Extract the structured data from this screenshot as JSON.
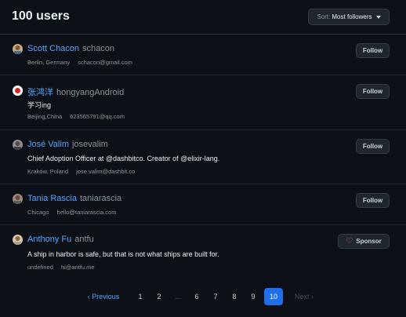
{
  "header": {
    "title": "100 users"
  },
  "sort": {
    "label": "Sort:",
    "value": "Most followers"
  },
  "users": [
    {
      "display_name": "Scott Chacon",
      "login": "schacon",
      "bio": "",
      "location": "Berlin, Germany",
      "email": "schacon@gmail.com",
      "action": "Follow"
    },
    {
      "display_name": "张鸿洋",
      "login": "hongyangAndroid",
      "bio": "学习ing",
      "location": "Beijing,China",
      "email": "623565791@qq.com",
      "action": "Follow"
    },
    {
      "display_name": "José Valim",
      "login": "josevalim",
      "bio": "Chief Adoption Officer at @dashbitco. Creator of @elixir-lang.",
      "location": "Kraków, Poland",
      "email": "jose.valim@dashbit.co",
      "action": "Follow"
    },
    {
      "display_name": "Tania Rascia",
      "login": "taniarascia",
      "bio": "",
      "location": "Chicago",
      "email": "hello@taniarascia.com",
      "action": "Follow"
    },
    {
      "display_name": "Anthony Fu",
      "login": "antfu",
      "bio": "A ship in harbor is safe, but that is not what ships are built for.",
      "location": "undefined",
      "email": "hi@antfu.me",
      "action": "Sponsor"
    }
  ],
  "pagination": {
    "prev": "Previous",
    "next": "Next",
    "gap": "…",
    "pages": [
      "1",
      "2",
      "6",
      "7",
      "8",
      "9",
      "10"
    ],
    "current": "10"
  },
  "colors": {
    "background": "#0d1117",
    "link": "#58a6ff",
    "current_page": "#1f6feb",
    "sponsor_heart": "#db61a2"
  }
}
